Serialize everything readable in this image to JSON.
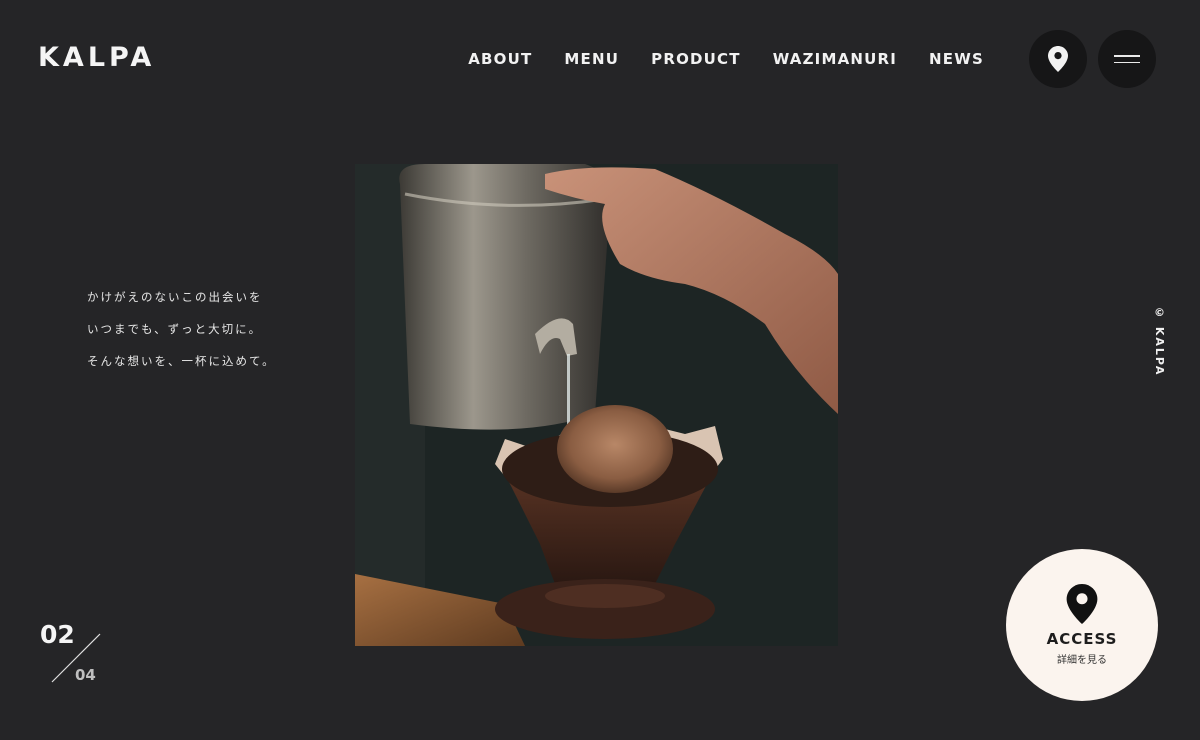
{
  "header": {
    "logo": "KALPA",
    "nav": [
      "ABOUT",
      "MENU",
      "PRODUCT",
      "WAZIMANURI",
      "NEWS"
    ],
    "map_icon": "map-pin-icon",
    "menu_icon": "hamburger-menu-icon"
  },
  "tagline": [
    "かけがえのないこの出会いを",
    "いつまでも、ずっと大切に。",
    "そんな想いを、一杯に込めて。"
  ],
  "side_label": "© KALPA",
  "slider": {
    "current": "02",
    "total": "04"
  },
  "access": {
    "title": "ACCESS",
    "subtitle": "詳細を見る",
    "icon": "map-pin-icon"
  },
  "colors": {
    "background": "#252527",
    "button": "#161617",
    "access_bg": "#fbf4ee"
  }
}
